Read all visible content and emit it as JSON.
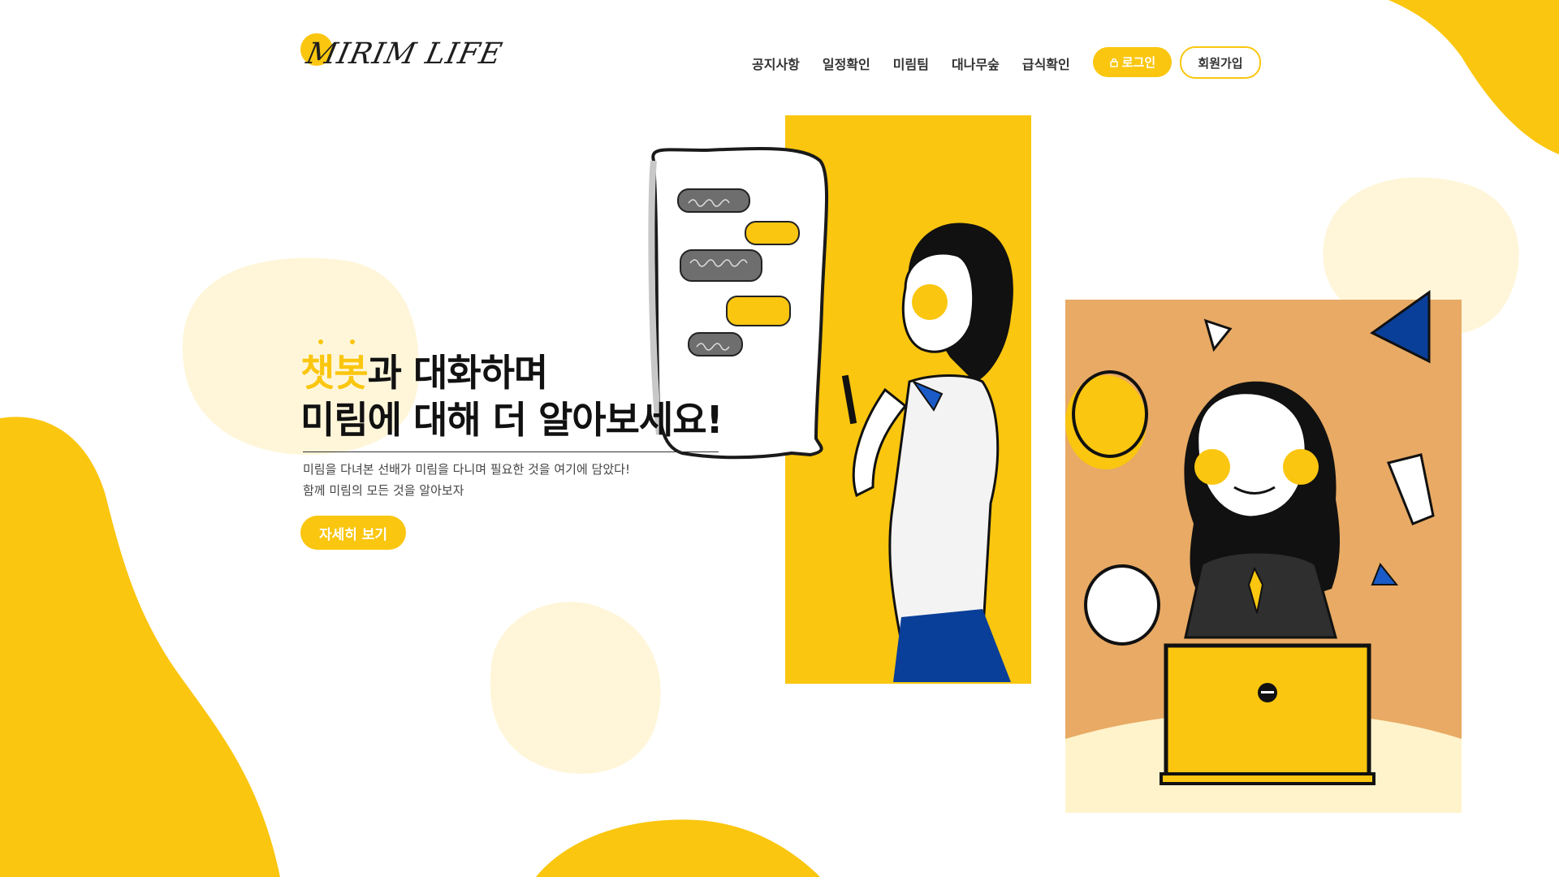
{
  "logo": {
    "text": "MIRIM LIFE"
  },
  "nav": {
    "items": [
      {
        "label": "공지사항"
      },
      {
        "label": "일정확인"
      },
      {
        "label": "미림팀"
      },
      {
        "label": "대나무숲"
      },
      {
        "label": "급식확인"
      }
    ],
    "login_label": "로그인",
    "signup_label": "회원가입"
  },
  "hero": {
    "accent": "챗봇",
    "line1_rest": "과 대화하며",
    "line2": "미림에 대해 더 알아보세요!",
    "desc1": "미림을 다녀본 선배가 미림을 다니며 필요한 것을 여기에 담았다!",
    "desc2": "함께 미림의 모든 것을 알아보자",
    "cta_label": "자세히 보기"
  },
  "icons": {
    "login": "lock-icon"
  },
  "colors": {
    "brand_yellow": "#fac60f",
    "cream": "#fff3cc",
    "orange_panel": "#e8aa64",
    "navy": "#0a3f99"
  }
}
